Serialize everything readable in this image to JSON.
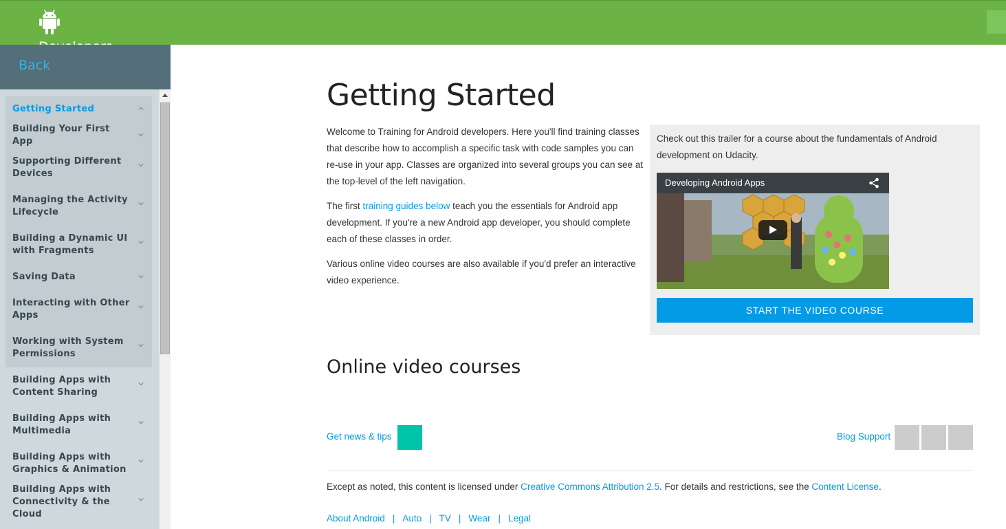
{
  "header": {
    "brand": "Developers",
    "back_label": "Back",
    "accent": "#6ab344"
  },
  "sidebar": {
    "active_item": "Getting Started",
    "group_items": [
      {
        "label": "Getting Started",
        "expanded": true
      },
      {
        "label": "Building Your First App"
      },
      {
        "label": "Supporting Different Devices"
      },
      {
        "label": "Managing the Activity Lifecycle"
      },
      {
        "label": "Building a Dynamic UI with Fragments"
      },
      {
        "label": "Saving Data"
      },
      {
        "label": "Interacting with Other Apps"
      },
      {
        "label": "Working with System Permissions"
      }
    ],
    "items": [
      {
        "label": "Building Apps with Content Sharing"
      },
      {
        "label": "Building Apps with Multimedia"
      },
      {
        "label": "Building Apps with Graphics & Animation"
      },
      {
        "label": "Building Apps with Connectivity & the Cloud"
      }
    ]
  },
  "main": {
    "title": "Getting Started",
    "intro_p1": "Welcome to Training for Android developers. Here you'll find training classes that describe how to accomplish a specific task with code samples you can re-use in your app. Classes are organized into several groups you can see at the top-level of the left navigation.",
    "intro_p2_before": "The first ",
    "intro_p2_link": "training guides below",
    "intro_p2_after": " teach you the essentials for Android app development. If you're a new Android app developer, you should complete each of these classes in order.",
    "intro_p3": "Various online video courses are also available if you'd prefer an interactive video experience.",
    "callout": {
      "text": "Check out this trailer for a course about the fundamentals of Android development on Udacity.",
      "video_title": "Developing Android Apps",
      "button_label": "START THE VIDEO COURSE"
    },
    "section_title": "Online video courses"
  },
  "footer": {
    "news_label": "Get news & tips",
    "blog_label": "Blog",
    "support_label": "Support",
    "license_before": "Except as noted, this content is licensed under ",
    "license_link1": "Creative Commons Attribution 2.5",
    "license_middle": ". For details and restrictions, see the ",
    "license_link2": "Content License",
    "license_after": ".",
    "links": [
      "About Android",
      "Auto",
      "TV",
      "Wear",
      "Legal"
    ]
  },
  "colors": {
    "link": "#039be5",
    "sidebar_bg": "#cfd8dc",
    "sidebar_head": "#546e7a",
    "button": "#039be5",
    "news_accent": "#00c4a7"
  }
}
